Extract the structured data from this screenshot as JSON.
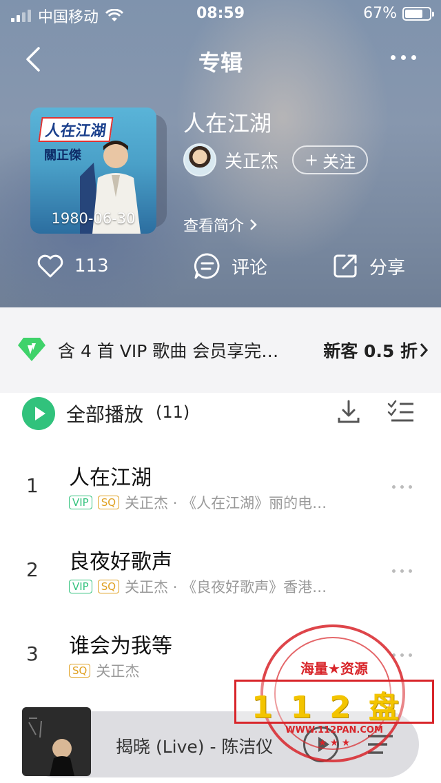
{
  "status_bar": {
    "carrier": "中国移动",
    "time": "08:59",
    "battery": "67%"
  },
  "nav": {
    "title": "专辑"
  },
  "album": {
    "cover_title": "人在江湖",
    "cover_artist": "關正傑",
    "release_date": "1980-06-30",
    "name": "人在江湖",
    "artist": "关正杰",
    "follow_label": "关注",
    "intro_label": "查看简介"
  },
  "actions": {
    "likes": "113",
    "comment_label": "评论",
    "share_label": "分享"
  },
  "vip_banner": {
    "text": "含 4 首 VIP 歌曲 会员享完…",
    "deal": "新客 0.5 折"
  },
  "play_all": {
    "label": "全部播放",
    "count": "(11)"
  },
  "songs": [
    {
      "index": "1",
      "title": "人在江湖",
      "badges": [
        "VIP",
        "SQ"
      ],
      "meta": "关正杰 · 《人在江湖》丽的电…"
    },
    {
      "index": "2",
      "title": "良夜好歌声",
      "badges": [
        "VIP",
        "SQ"
      ],
      "meta": "关正杰 · 《良夜好歌声》香港…"
    },
    {
      "index": "3",
      "title": "谁会为我等",
      "badges": [
        "SQ"
      ],
      "meta": "关正杰"
    }
  ],
  "player": {
    "now_playing": "揭晓 (Live) - 陈洁仪"
  },
  "watermark": {
    "top": "海量★资源",
    "big": "112盘",
    "url": "WWW.112PAN.COM"
  },
  "colors": {
    "accent": "#31c27c",
    "sq": "#e0a020",
    "stamp": "#d8252a"
  },
  "icons": [
    "back-icon",
    "more-icon",
    "heart-icon",
    "comment-icon",
    "share-icon",
    "diamond-icon",
    "play-icon",
    "download-icon",
    "multi-select-icon",
    "playlist-icon"
  ]
}
